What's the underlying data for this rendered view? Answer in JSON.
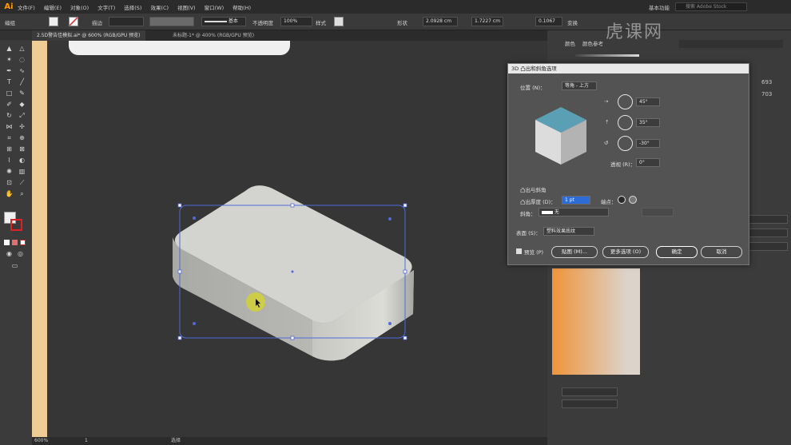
{
  "menubar": {
    "app_logo": "Ai",
    "items": [
      "文件(F)",
      "编辑(E)",
      "对象(O)",
      "文字(T)",
      "选择(S)",
      "效果(C)",
      "视图(V)",
      "窗口(W)",
      "帮助(H)"
    ],
    "workspace": "基本功能",
    "search_placeholder": "搜索 Adobe Stock"
  },
  "controlbar": {
    "selection_label": "编组",
    "stroke_label": "描边",
    "stroke_style": "基本",
    "opacity_label": "不透明度",
    "opacity_value": "100%",
    "style_label": "样式",
    "shape_label": "形状",
    "x_value": "2.0928 cm",
    "y_value": "1.7227 cm",
    "corner_value": "0.1067",
    "transform_label": "变换"
  },
  "tabs": [
    {
      "label": "2.5D警告佳模拟.ai* @ 600% (RGB/GPU 预览)",
      "active": true
    },
    {
      "label": "未标题-1* @ 400% (RGB/GPU 预览)",
      "active": false
    }
  ],
  "statusbar": {
    "zoom": "600%",
    "page": "1",
    "tool": "选择"
  },
  "right_panel": {
    "tab_color": "颜色",
    "tab_color_guide": "颜色参考",
    "fields": [
      "693",
      "703"
    ]
  },
  "dialog": {
    "title": "3D 凸出和斜角选项",
    "position_label": "位置 (N)：",
    "position_value": "等角 - 上方",
    "angle_x": "45°",
    "angle_y": "35°",
    "angle_z": "-30°",
    "perspective_label": "透视 (R)：",
    "perspective_value": "0°",
    "extrude_section": "凸出与斜角",
    "extrude_depth_label": "凸出厚度 (D)：",
    "extrude_depth_value": "1 pt",
    "cap_label": "端点：",
    "bevel_label": "斜角：",
    "bevel_value": "无",
    "surface_label": "表面 (S)：",
    "surface_value": "塑料效果底纹",
    "preview_label": "预览 (P)",
    "map_button": "贴图 (M)...",
    "more_options_button": "更多选项 (O)",
    "ok_button": "确定",
    "cancel_button": "取消"
  },
  "watermark": "虎课网",
  "colors": {
    "artboard": "#efcc96",
    "cube_top": "#5b9fb5",
    "selection": "#4f6bd8",
    "gradient_start": "#f0943a",
    "gradient_end": "#dcd3cb"
  }
}
